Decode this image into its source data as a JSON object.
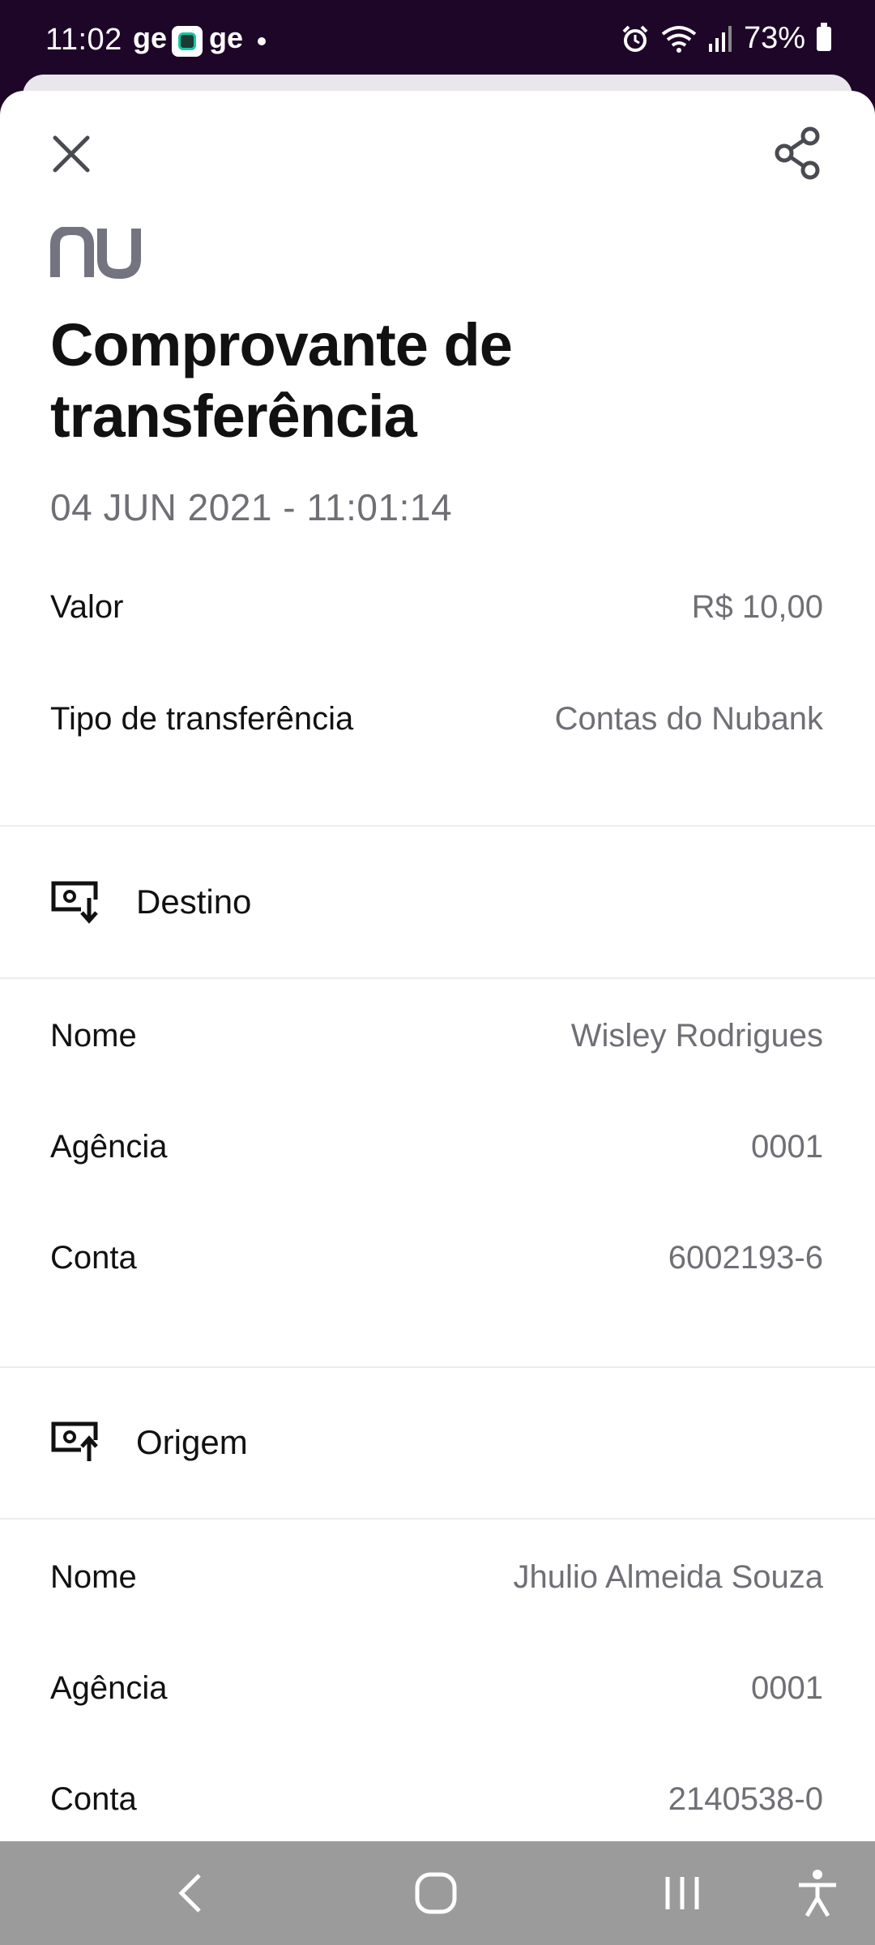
{
  "status_bar": {
    "time": "11:02",
    "app_label_1": "ge",
    "app_label_2": "ge",
    "battery": "73%",
    "icons": [
      "app-icon",
      "alarm-icon",
      "wifi-icon",
      "signal-icon",
      "battery-icon"
    ]
  },
  "header": {
    "close_icon": "close-icon",
    "share_icon": "share-icon",
    "logo_text": "nu"
  },
  "receipt": {
    "title": "Comprovante de transferência",
    "timestamp": "04 JUN 2021 - 11:01:14",
    "summary": [
      {
        "label": "Valor",
        "value": "R$ 10,00"
      },
      {
        "label": "Tipo de transferência",
        "value": "Contas do Nubank"
      }
    ],
    "destino": {
      "label": "Destino",
      "icon": "receive-money-icon",
      "fields": [
        {
          "label": "Nome",
          "value": "Wisley Rodrigues"
        },
        {
          "label": "Agência",
          "value": "0001"
        },
        {
          "label": "Conta",
          "value": "6002193-6"
        }
      ]
    },
    "origem": {
      "label": "Origem",
      "icon": "send-money-icon",
      "fields": [
        {
          "label": "Nome",
          "value": "Jhulio Almeida Souza"
        },
        {
          "label": "Agência",
          "value": "0001"
        },
        {
          "label": "Conta",
          "value": "2140538-0"
        }
      ]
    }
  },
  "nav_bar": {
    "icons": [
      "back-icon",
      "home-icon",
      "recents-icon",
      "accessibility-icon"
    ]
  },
  "colors": {
    "status_bar_bg": "#1e0628",
    "primary_text": "#111111",
    "secondary_text": "#6f6f75",
    "logo": "#747480",
    "nav_bar_bg": "#9b9b9b"
  }
}
